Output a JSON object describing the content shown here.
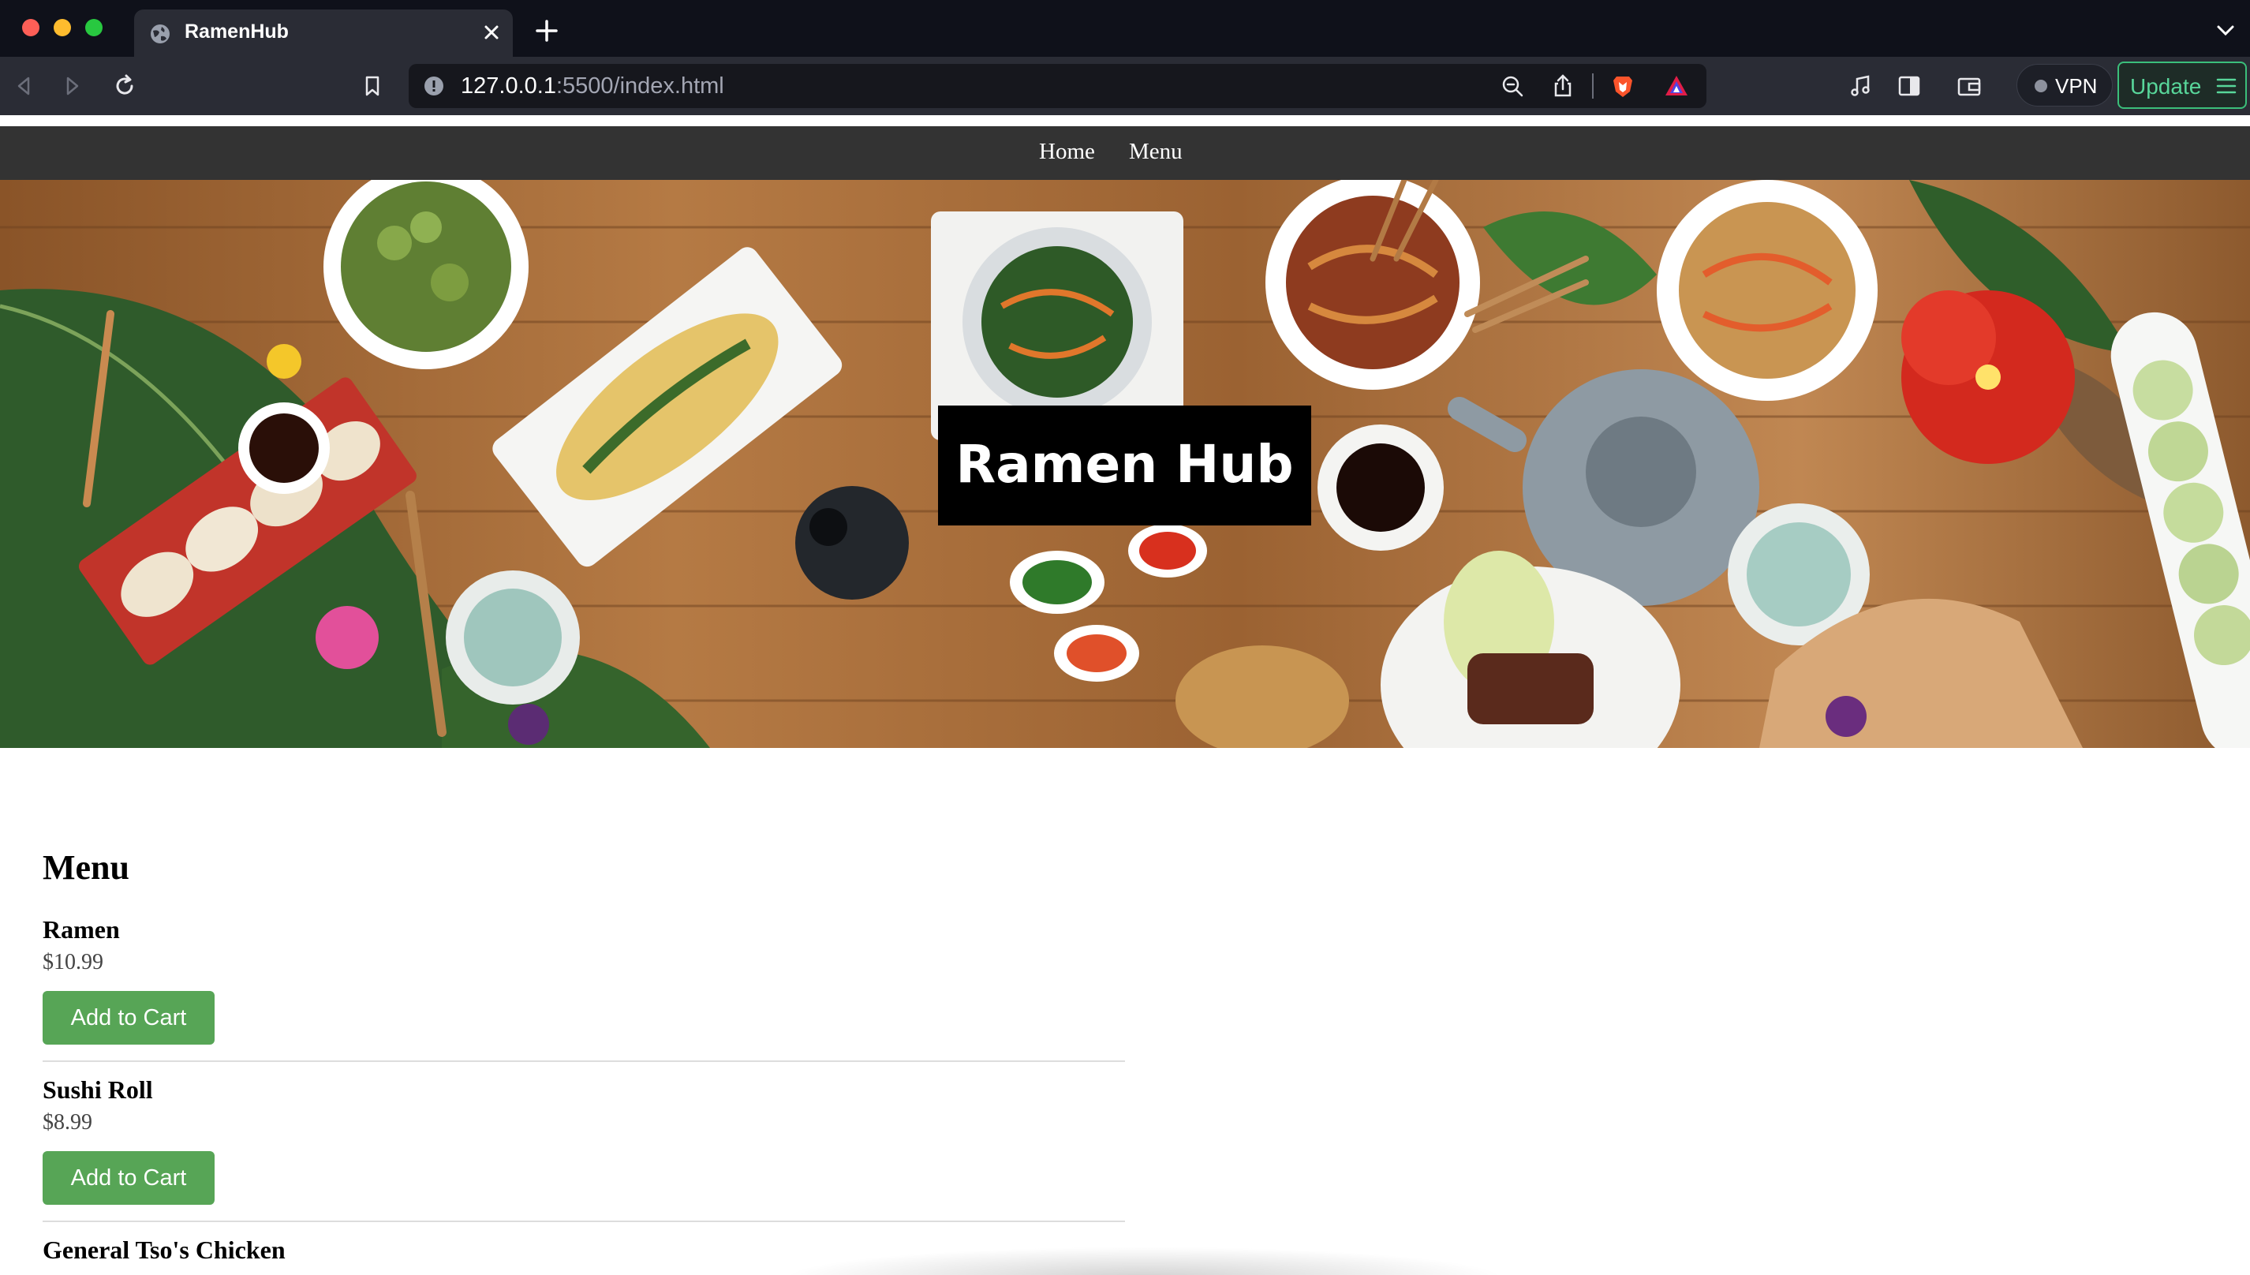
{
  "browser": {
    "tab_title": "RamenHub",
    "url_host": "127.0.0.1",
    "url_rest": ":5500/index.html",
    "vpn_label": "VPN",
    "update_label": "Update"
  },
  "nav": {
    "home": "Home",
    "menu": "Menu"
  },
  "hero": {
    "title": "Ramen Hub"
  },
  "menu": {
    "heading": "Menu",
    "items": [
      {
        "name": "Ramen",
        "price": "$10.99",
        "button": "Add to Cart"
      },
      {
        "name": "Sushi Roll",
        "price": "$8.99",
        "button": "Add to Cart"
      },
      {
        "name": "General Tso's Chicken"
      }
    ]
  },
  "colors": {
    "nav_bg": "#333333",
    "button_bg": "#57a556",
    "update_accent": "#3bbf7b"
  }
}
